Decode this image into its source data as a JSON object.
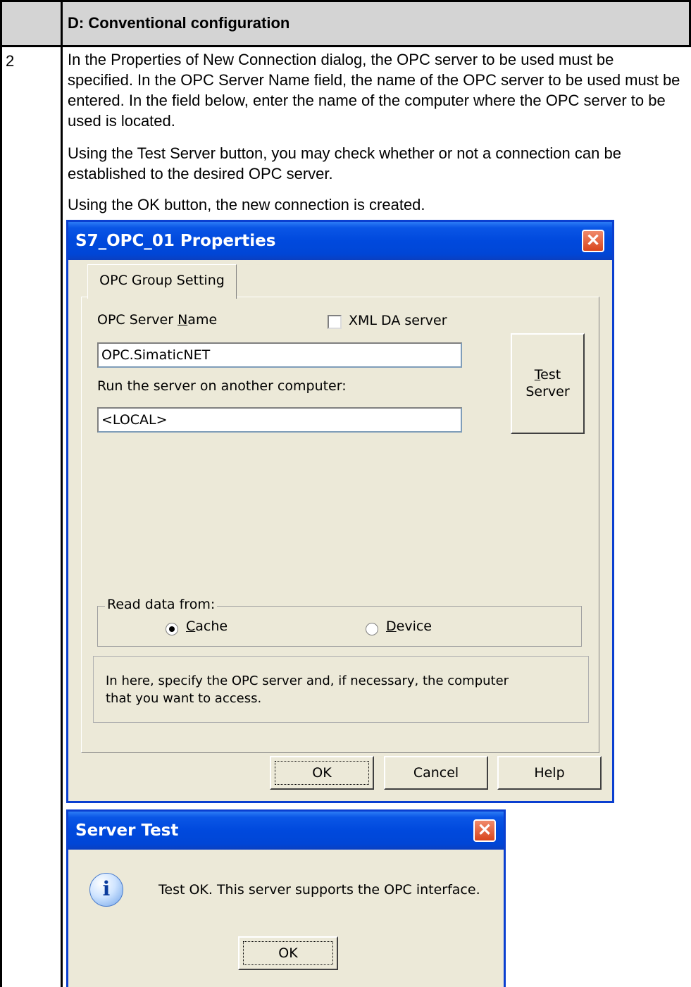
{
  "table": {
    "header_title": "D: Conventional configuration",
    "step_number": "2",
    "paragraphs": [
      "In the Properties of New Connection dialog, the OPC server to be used must be specified. In the OPC Server Name field, the name of the OPC server to be used must be entered. In the field below, enter the name of the computer where the OPC server to be used is located.",
      "Using the Test Server button, you may check whether or not a connection can be established to the desired OPC server.",
      "Using the OK button, the new connection is created."
    ]
  },
  "properties_dialog": {
    "title": "S7_OPC_01 Properties",
    "tab_label": "OPC Group Setting",
    "server_name_label_pre": "OPC Server ",
    "server_name_label_u": "N",
    "server_name_label_post": "ame",
    "xml_checkbox_label": "XML DA server",
    "xml_checked": false,
    "server_name_value": "OPC.SimaticNET",
    "remote_label": "Run the server on another computer:",
    "remote_value": "<LOCAL>",
    "test_btn_u": "T",
    "test_btn_line1_rest": "est",
    "test_btn_line2": "Server",
    "read_group_label": "Read data from:",
    "radio_cache_u": "C",
    "radio_cache_rest": "ache",
    "radio_device_u": "D",
    "radio_device_rest": "evice",
    "selected_source": "Cache",
    "info_text_line1": "In here, specify the OPC server and, if necessary, the computer",
    "info_text_line2": "that you want to access.",
    "ok_label": "OK",
    "cancel_label": "Cancel",
    "help_label": "Help"
  },
  "server_test_dialog": {
    "title": "Server Test",
    "message": "Test OK. This server supports the OPC interface.",
    "ok_label": "OK",
    "icon": "info-icon"
  },
  "colors": {
    "titlebar": "#0049dd",
    "dialog_bg": "#ece9d8",
    "close_button": "#d8451d"
  }
}
